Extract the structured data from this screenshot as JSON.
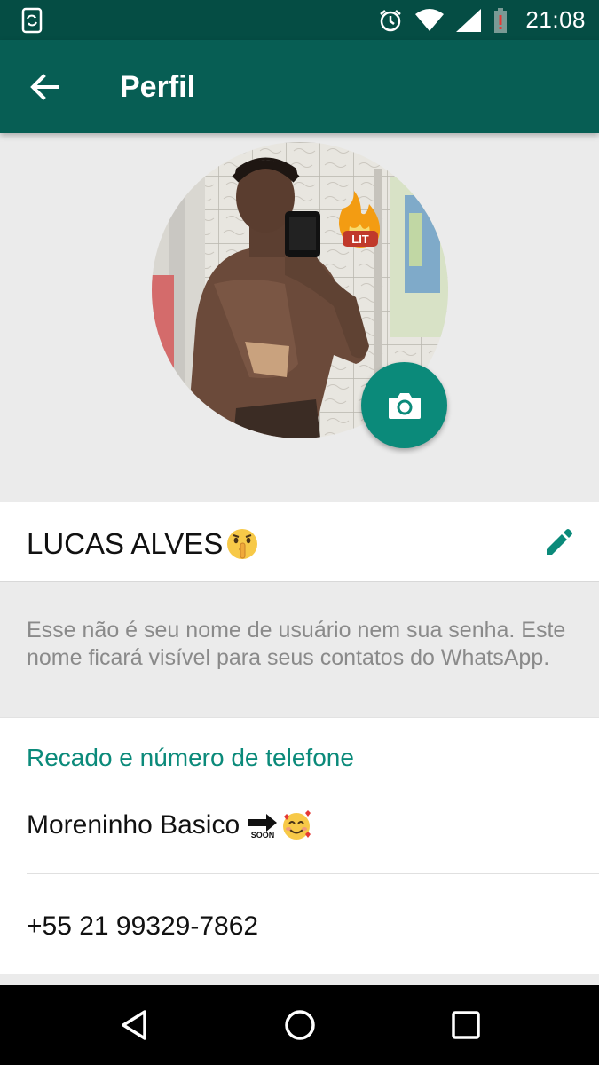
{
  "status_bar": {
    "time": "21:08",
    "icons": [
      "phone-sync-icon",
      "alarm-icon",
      "wifi-icon",
      "signal-icon",
      "battery-low-icon"
    ]
  },
  "app_bar": {
    "title": "Perfil",
    "back_icon": "arrow-left-icon"
  },
  "profile": {
    "photo_badge_text": "LIT",
    "camera_icon": "camera-icon",
    "name": "LUCAS ALVES",
    "name_emoji": "shushing-face-emoji",
    "edit_icon": "pencil-icon",
    "hint": "Esse não é seu nome de usuário nem sua senha. Este nome ficará visível para seus contatos do WhatsApp."
  },
  "info": {
    "section_title": "Recado e número de telefone",
    "status": "Moreninho Basico",
    "status_soon": "SOON",
    "status_emoji": "smiling-face-with-hearts-emoji",
    "phone": "+55 21 99329-7862"
  },
  "nav": {
    "back_icon": "triangle-back-icon",
    "home_icon": "circle-home-icon",
    "recents_icon": "square-recents-icon"
  },
  "colors": {
    "status_bar": "#054d44",
    "app_bar": "#075e54",
    "accent": "#0b8a7a"
  }
}
